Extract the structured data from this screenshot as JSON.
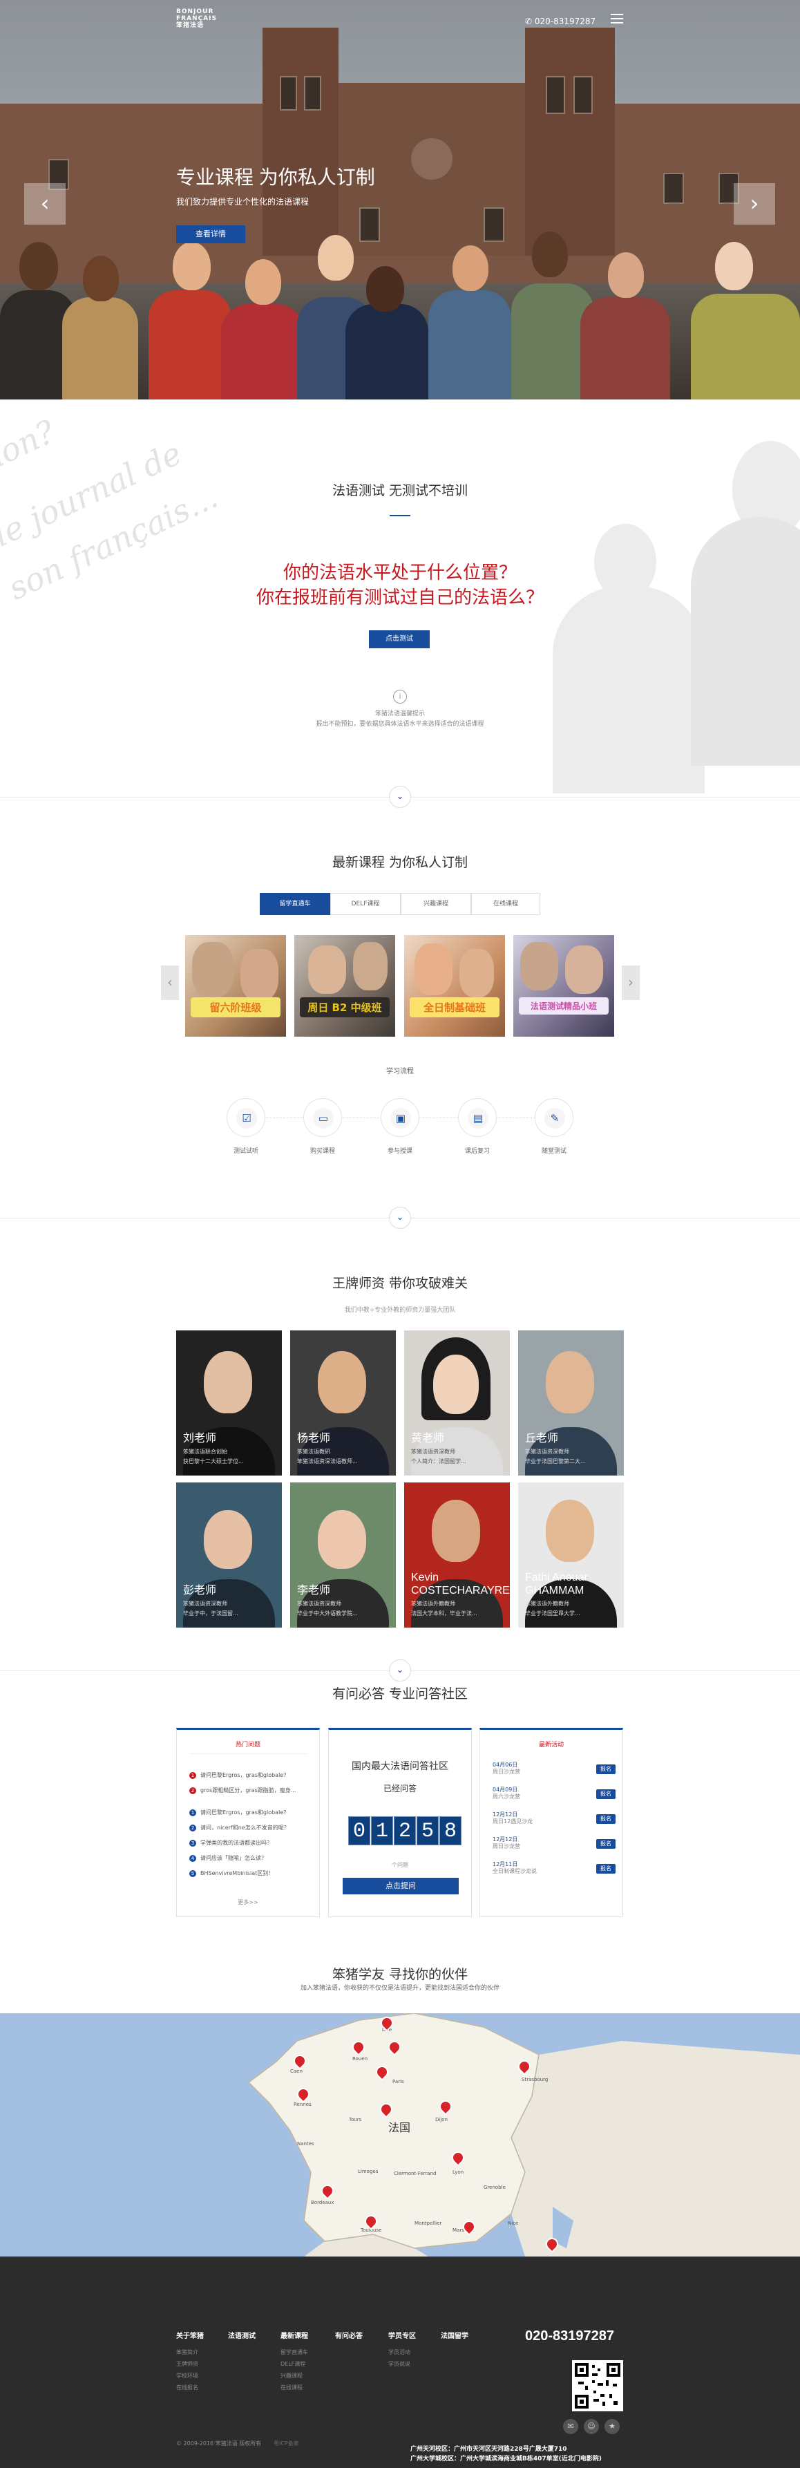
{
  "header": {
    "logo_line1": "BONJOUR",
    "logo_line2": "FRANÇAIS",
    "logo_line3": "笨猪法语",
    "phone": "020-83197287"
  },
  "hero": {
    "title": "专业课程 为你私人订制",
    "subtitle": "我们致力提供专业个性化的法语课程",
    "button": "查看详情",
    "prev": "‹",
    "next": "›"
  },
  "test": {
    "script_words": [
      "non?",
      "le journal de",
      "son français..."
    ],
    "title": "法语测试 无测试不培训",
    "question_line1": "你的法语水平处于什么位置？",
    "question_line2": "你在报班前有测试过自己的法语么？",
    "button": "点击测试",
    "info_icon": "i",
    "note1": "笨猪法语温馨提示",
    "note2": "报出不能预扣，要依据您具体法语水平来选择适合的法语课程"
  },
  "courses": {
    "title": "最新课程 为你私人订制",
    "tabs": [
      "留学直通车",
      "DELF课程",
      "兴趣课程",
      "在线课程"
    ],
    "cards": [
      {
        "banner": "留六阶班级",
        "color": "#e8731e"
      },
      {
        "banner": "周日 B2 中级班",
        "color": "#e6c21e"
      },
      {
        "banner": "全日制基础班",
        "color": "#e8731e"
      },
      {
        "banner": "法语测试精品小班",
        "color": "#c94fa8"
      }
    ],
    "prev": "‹",
    "next": "›",
    "process_title": "学习流程",
    "steps": [
      {
        "label": "测试试听",
        "icon": "check-icon"
      },
      {
        "label": "购买课程",
        "icon": "screen-icon"
      },
      {
        "label": "参与授课",
        "icon": "presentation-icon"
      },
      {
        "label": "课后复习",
        "icon": "book-icon"
      },
      {
        "label": "随堂测试",
        "icon": "pencil-icon"
      }
    ]
  },
  "teachers": {
    "title": "王牌师资 带你攻破难关",
    "subtitle": "我们中教+专业外教的师资力量强大团队",
    "list": [
      {
        "name": "刘老师",
        "title": "笨猪法语联合创始",
        "desc": "获巴黎十二大硕士学位..."
      },
      {
        "name": "杨老师",
        "title": "笨猪法语教研",
        "desc": "笨猪法语资深法语教师..."
      },
      {
        "name": "黄老师",
        "title": "笨猪法语资深教师",
        "desc": "个人简介：法国留学..."
      },
      {
        "name": "丘老师",
        "title": "笨猪法语资深教师",
        "desc": "毕业于法国巴黎第二大..."
      },
      {
        "name": "彭老师",
        "title": "笨猪法语资深教师",
        "desc": "毕业于中，于法国留..."
      },
      {
        "name": "李老师",
        "title": "笨猪法语资深教师",
        "desc": "毕业于中大外语教学院..."
      },
      {
        "name": "Kevin COSTECHARAYRE",
        "title": "笨猪法语外籍教师",
        "desc": "法国大学本科，毕业于法..."
      },
      {
        "name": "Fathi Anouar GHAMMAM",
        "title": "笨猪法语外籍教师",
        "desc": "毕业于法国里昂大学..."
      }
    ]
  },
  "qa": {
    "title": "有问必答 专业问答社区",
    "hot_title": "热门问题",
    "hot": [
      "请问巴黎Ergros，gras和globale?",
      "gros跟粗糙区分，gras跟脂肪，瘦身...",
      "请问巴黎Ergros，gras和globale?",
      "请问，nicerf和ne怎么不发音的呢？",
      "学弹类的我的法语都读出吗？",
      "请问应该「隐喻」怎么读？",
      "BHSenvivreMbinisiat区别！"
    ],
    "more": "更多>>",
    "community_title": "国内最大法语问答社区",
    "answered_label": "已经问答",
    "digits": [
      "0",
      "1",
      "2",
      "5",
      "8"
    ],
    "unit": "个问题",
    "ask_button": "点击提问",
    "events_title": "最新活动",
    "events": [
      {
        "date": "04月06日",
        "text": "周日沙龙营",
        "tag": "报名"
      },
      {
        "date": "04月09日",
        "text": "周六沙龙营",
        "tag": "报名"
      },
      {
        "date": "12月12日",
        "text": "周日12遇见沙龙",
        "tag": "报名"
      },
      {
        "date": "12月12日",
        "text": "周日沙龙营",
        "tag": "报名"
      },
      {
        "date": "12月11日",
        "text": "全日制课程沙龙说",
        "tag": "报名"
      }
    ]
  },
  "community": {
    "title": "笨猪学友 寻找你的伙伴",
    "subtitle": "加入笨猪法语，你收获的不仅仅是法语提升，更能找到法国适合你的伙伴",
    "country": "法国",
    "cities": [
      "Lille",
      "Rouen",
      "Caen",
      "Paris",
      "Rennes",
      "Strasbourg",
      "Dijon",
      "Nantes",
      "Tours",
      "Lyon",
      "Bordeaux",
      "Toulouse",
      "Montpellier",
      "Marseille",
      "Nice",
      "Limoges",
      "Clermont-Ferrand",
      "Grenoble"
    ]
  },
  "footer": {
    "columns": [
      {
        "head": "关于笨猪",
        "links": [
          "笨猪简介",
          "王牌师资",
          "学校环境",
          "在线报名"
        ]
      },
      {
        "head": "法语测试",
        "links": []
      },
      {
        "head": "最新课程",
        "links": [
          "留学直通车",
          "DELF课程",
          "兴趣课程",
          "在线课程"
        ]
      },
      {
        "head": "有问必答",
        "links": []
      },
      {
        "head": "学员专区",
        "links": [
          "学员活动",
          "学员说说"
        ]
      },
      {
        "head": "法国留学",
        "links": []
      }
    ],
    "phone": "020-83197287",
    "social": [
      "✉",
      "☺",
      "★"
    ],
    "copyright": "© 2009-2016 笨猪法语 版权所有",
    "icp": "粤ICP备案",
    "address1": "广州天河校区：广州市天河区天河路228号广晟大厦710",
    "address2": "广州大学城校区：广州大学城滨海商业城B栋407单室(近北门电影院)"
  }
}
